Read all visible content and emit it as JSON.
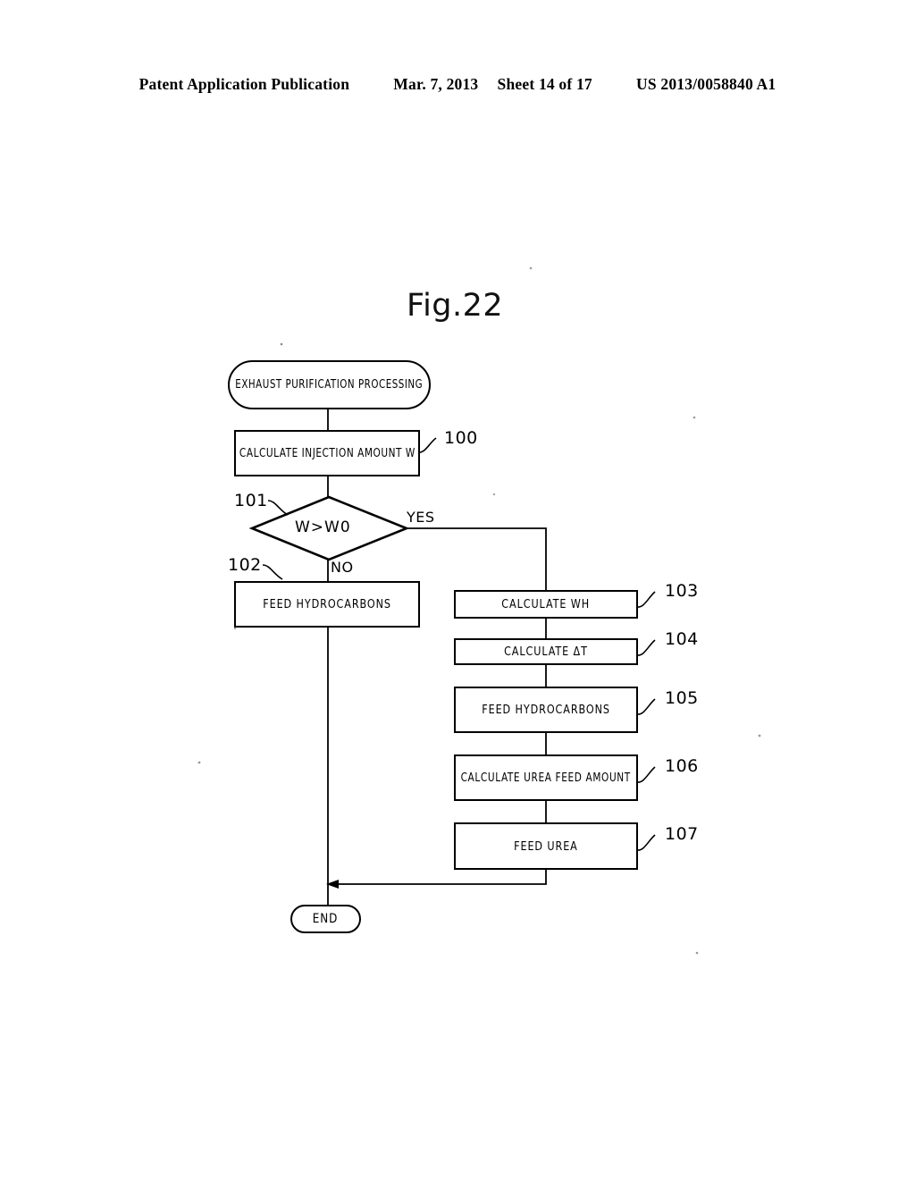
{
  "header": {
    "publication": "Patent Application Publication",
    "date": "Mar. 7, 2013",
    "sheet": "Sheet 14 of 17",
    "number": "US 2013/0058840 A1"
  },
  "figure": {
    "title": "Fig.22"
  },
  "flowchart": {
    "start": {
      "label": "EXHAUST PURIFICATION PROCESSING"
    },
    "end": {
      "label": "END"
    },
    "steps": [
      {
        "ref": "100",
        "label": "CALCULATE INJECTION AMOUNT W"
      },
      {
        "ref": "101",
        "label": "W>W0"
      },
      {
        "ref": "102",
        "label": "FEED HYDROCARBONS"
      },
      {
        "ref": "103",
        "label": "CALCULATE WH"
      },
      {
        "ref": "104",
        "label": "CALCULATE ΔT"
      },
      {
        "ref": "105",
        "label": "FEED HYDROCARBONS"
      },
      {
        "ref": "106",
        "label": "CALCULATE UREA FEED AMOUNT"
      },
      {
        "ref": "107",
        "label": "FEED UREA"
      }
    ],
    "branches": {
      "yes": "YES",
      "no": "NO"
    }
  },
  "colors": {
    "ink": "#000000",
    "paper": "#ffffff"
  }
}
